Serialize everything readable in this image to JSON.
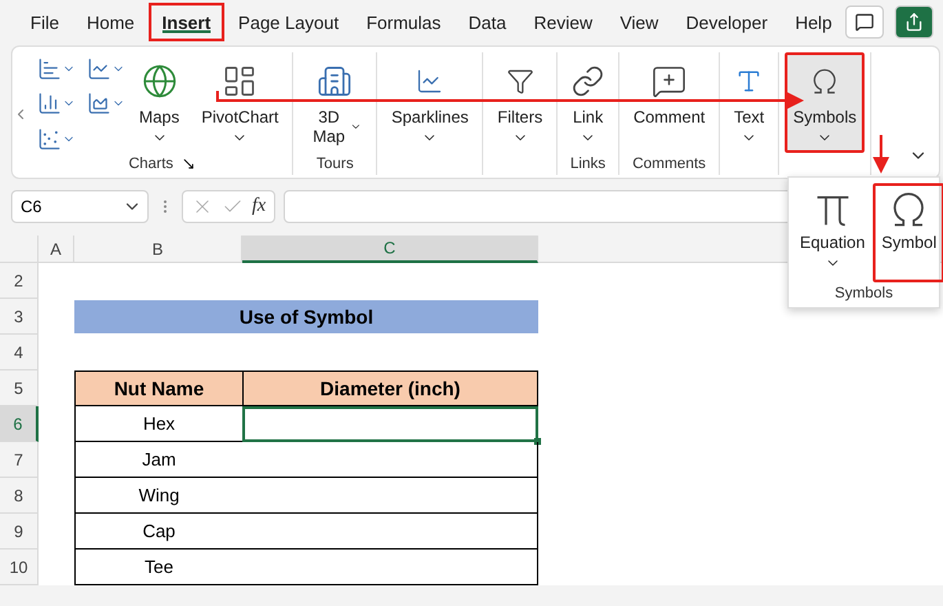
{
  "menu": {
    "tabs": [
      {
        "label": "File",
        "selected": false,
        "highlighted": false
      },
      {
        "label": "Home",
        "selected": false,
        "highlighted": false
      },
      {
        "label": "Insert",
        "selected": true,
        "highlighted": true
      },
      {
        "label": "Page Layout",
        "selected": false,
        "highlighted": false
      },
      {
        "label": "Formulas",
        "selected": false,
        "highlighted": false
      },
      {
        "label": "Data",
        "selected": false,
        "highlighted": false
      },
      {
        "label": "Review",
        "selected": false,
        "highlighted": false
      },
      {
        "label": "View",
        "selected": false,
        "highlighted": false
      },
      {
        "label": "Developer",
        "selected": false,
        "highlighted": false
      },
      {
        "label": "Help",
        "selected": false,
        "highlighted": false
      }
    ]
  },
  "ribbon": {
    "groups": [
      {
        "kind": "charts",
        "label": "Charts",
        "buttons": [
          {
            "label": "Maps",
            "kind": "plain",
            "dropdown": true,
            "selected": false,
            "highlighted": false
          },
          {
            "label": "PivotChart",
            "kind": "plain",
            "dropdown": true,
            "selected": false,
            "highlighted": false
          }
        ]
      },
      {
        "kind": "standard",
        "label": "Tours",
        "buttons": [
          {
            "label": "3D Map",
            "kind": "wrapped",
            "dropdown": true,
            "selected": false,
            "highlighted": false
          }
        ]
      },
      {
        "kind": "standard",
        "buttons": [
          {
            "label": "Sparklines",
            "kind": "plain",
            "dropdown": true,
            "selected": false,
            "highlighted": false
          }
        ]
      },
      {
        "kind": "standard",
        "buttons": [
          {
            "label": "Filters",
            "kind": "plain",
            "dropdown": true,
            "selected": false,
            "highlighted": false
          }
        ]
      },
      {
        "kind": "standard",
        "label": "Links",
        "buttons": [
          {
            "label": "Link",
            "kind": "plain",
            "dropdown": true,
            "selected": false,
            "highlighted": false
          }
        ]
      },
      {
        "kind": "standard",
        "label": "Comments",
        "buttons": [
          {
            "label": "Comment",
            "kind": "plain",
            "dropdown": false,
            "selected": false,
            "highlighted": false
          }
        ]
      },
      {
        "kind": "standard",
        "buttons": [
          {
            "label": "Text",
            "kind": "plain",
            "dropdown": true,
            "selected": false,
            "highlighted": false
          }
        ]
      },
      {
        "kind": "standard",
        "buttons": [
          {
            "label": "Symbols",
            "kind": "plain",
            "dropdown": true,
            "selected": true,
            "highlighted": true
          }
        ]
      }
    ]
  },
  "symbols_menu": {
    "label": "Symbols",
    "buttons": [
      {
        "label": "Equation",
        "dropdown": true,
        "highlighted": false
      },
      {
        "label": "Symbol",
        "dropdown": false,
        "highlighted": true
      }
    ]
  },
  "formula_bar": {
    "name_box": "C6",
    "function_label": "fx"
  },
  "sheet": {
    "columns": [
      {
        "label": "A",
        "selected": false
      },
      {
        "label": "B",
        "selected": false
      },
      {
        "label": "C",
        "selected": true
      }
    ],
    "rows": [
      {
        "label": "2",
        "selected": false
      },
      {
        "label": "3",
        "selected": false
      },
      {
        "label": "4",
        "selected": false
      },
      {
        "label": "5",
        "selected": false
      },
      {
        "label": "6",
        "selected": true
      },
      {
        "label": "7",
        "selected": false
      },
      {
        "label": "8",
        "selected": false
      },
      {
        "label": "9",
        "selected": false
      },
      {
        "label": "10",
        "selected": false
      }
    ],
    "title": "Use of Symbol",
    "table": {
      "columns": [
        "Nut Name",
        "Diameter (inch)"
      ],
      "rows": [
        {
          "name": "Hex",
          "selected": true
        },
        {
          "name": "Jam",
          "selected": false
        },
        {
          "name": "Wing",
          "selected": false
        },
        {
          "name": "Cap",
          "selected": false
        },
        {
          "name": "Tee",
          "selected": false
        }
      ]
    }
  }
}
